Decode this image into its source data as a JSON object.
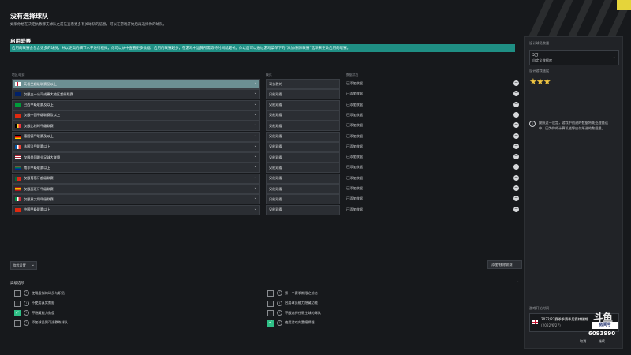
{
  "header": {
    "title": "没有选择球队",
    "description": "如果你想在决定执教哪支球队之前先查看更多有关球队的信息，可以在游戏开始后再选择你的球队。"
  },
  "leagues_section": {
    "title": "启用联赛",
    "banner": "启用的联赛会包含更多的球员，并以更高的细节水平进行模拟，你可以从中查看更多数据。启用的联赛越多，在游戏中运算所需等待时间就越长。你以后可以通过游戏菜单下的“添加/删除联赛”选项来更改启用的联赛。",
    "col_league": "地区/联赛",
    "col_mode": "模式",
    "col_status": "数据状况",
    "rows": [
      {
        "flag": "england",
        "name": "英格兰超级联赛至以上",
        "mode": "可执教的",
        "status": "已添加数据"
      },
      {
        "flag": "australia",
        "name": "仅限五十公司或更大地区超级联赛",
        "mode": "只能观看",
        "status": "已添加数据"
      },
      {
        "flag": "brazil",
        "name": "巴西甲级联赛及以上",
        "mode": "只能观看",
        "status": "已添加数据"
      },
      {
        "flag": "china",
        "name": "仅限中国甲级联赛及以上",
        "mode": "只能观看",
        "status": "已添加数据"
      },
      {
        "flag": "belgium",
        "name": "仅限比利时甲级联赛",
        "mode": "只能观看",
        "status": "已添加数据"
      },
      {
        "flag": "germany",
        "name": "德国德甲联赛及以上",
        "mode": "只能观看",
        "status": "已添加数据"
      },
      {
        "flag": "france",
        "name": "法国法甲联赛以上",
        "mode": "只能观看",
        "status": "已添加数据"
      },
      {
        "flag": "usa",
        "name": "仅限美国职业足球大联盟",
        "mode": "只能观看",
        "status": "已添加数据"
      },
      {
        "flag": "south-africa",
        "name": "南非甲级联赛以上",
        "mode": "只能观看",
        "status": "已添加数据"
      },
      {
        "flag": "portugal",
        "name": "仅限葡萄牙超级联赛",
        "mode": "只能观看",
        "status": "已添加数据"
      },
      {
        "flag": "spain",
        "name": "仅限西班牙甲级联赛",
        "mode": "只能观看",
        "status": "已添加数据"
      },
      {
        "flag": "italy",
        "name": "仅限意大利甲级联赛",
        "mode": "只能观看",
        "status": "已添加数据"
      },
      {
        "flag": "china",
        "name": "中国甲级联赛以上",
        "mode": "只能观看",
        "status": "已添加数据"
      }
    ],
    "bottom_dropdown": "游戏设置",
    "add_button": "添加/移除联赛"
  },
  "advanced": {
    "title": "高级选项",
    "left_options": [
      {
        "label": "使用虚拟的球员与职员",
        "checked": false
      },
      {
        "label": "不使用真实数据",
        "checked": false
      },
      {
        "label": "不隐藏能力数值",
        "checked": true
      },
      {
        "label": "添加球员到可选教练球队",
        "checked": false
      }
    ],
    "right_options": [
      {
        "label": "第一个赛季期限之前合",
        "checked": false
      },
      {
        "label": "启用球员能力隐藏功能",
        "checked": false
      },
      {
        "label": "不限选择任教主球的球队",
        "checked": false
      },
      {
        "label": "使用游戏内置编辑器",
        "checked": true
      }
    ]
  },
  "right_panel": {
    "db_size_label": "设计球员数量",
    "db_size_value": "5万",
    "db_size_sub": "自定义数据库",
    "speed_label": "设计游戏速度",
    "stars_filled": 2.5,
    "stars_total": 5,
    "speed_text": "按照这一设定，游戏中创建的数据将耗处理量适中，因为你的计算机能够应付所选的数据量。",
    "start_date_label": "游戏开始时间",
    "start_date_line1": "2022/23赛季季赛季后赛转移期",
    "start_date_line2": "(2022/6/27)",
    "cancel": "取消",
    "continue": "继续"
  },
  "watermark": {
    "logo": "斗鱼",
    "room": "房间号",
    "number": "6093990"
  },
  "colors": {
    "accent": "#1f8f84",
    "check": "#2fbf86",
    "star": "#f0c542",
    "background": "#17191c"
  }
}
